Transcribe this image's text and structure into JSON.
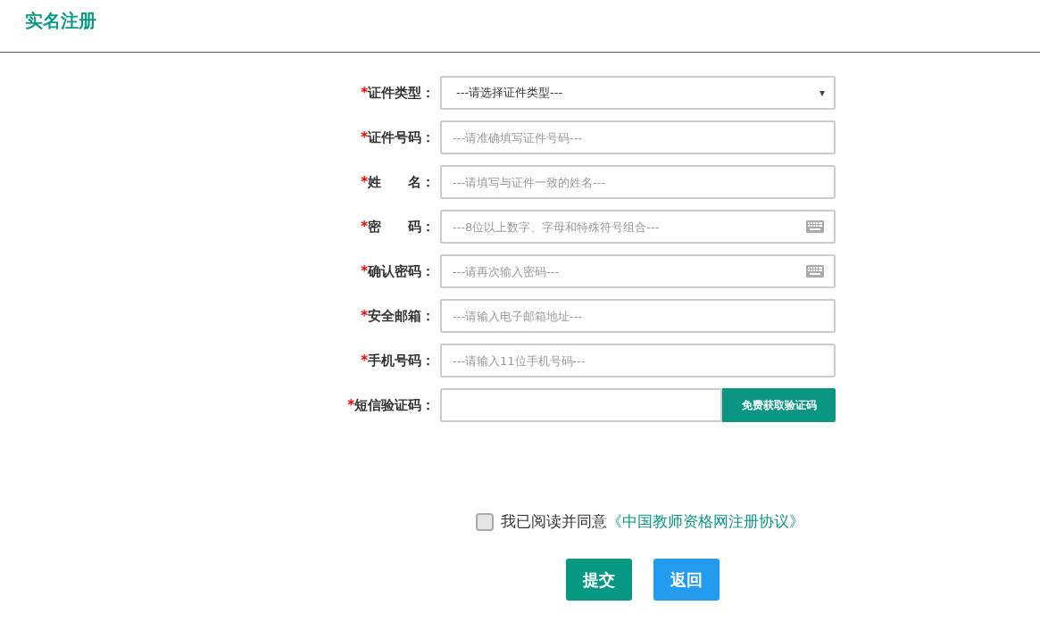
{
  "title": "实名注册",
  "fields": [
    {
      "kind": "select",
      "mark": "*",
      "label": "证件类型：",
      "value": "---请选择证件类型---",
      "caret": "▾"
    },
    {
      "kind": "text",
      "mark": "*",
      "label": "证件号码：",
      "placeholder": "---请准确填写证件号码---"
    },
    {
      "kind": "text",
      "mark": "*",
      "label": "姓　　名：",
      "placeholder": "---请填写与证件一致的姓名---"
    },
    {
      "kind": "password",
      "mark": "*",
      "label": "密　　码：",
      "placeholder": "---8位以上数字、字母和特殊符号组合---"
    },
    {
      "kind": "password",
      "mark": "*",
      "label": "确认密码：",
      "placeholder": "---请再次输入密码---"
    },
    {
      "kind": "text",
      "mark": "*",
      "label": "安全邮箱：",
      "placeholder": "---请输入电子邮箱地址---"
    },
    {
      "kind": "text",
      "mark": "*",
      "label": "手机号码：",
      "placeholder": "---请输入11位手机号码---"
    },
    {
      "kind": "sms",
      "mark": "*",
      "label": "短信验证码：",
      "button": "免费获取验证码"
    }
  ],
  "agreement": {
    "checked": false,
    "text": "我已阅读并同意",
    "link": "《中国教师资格网注册协议》"
  },
  "buttons": [
    {
      "kind": "primary",
      "label": "提交"
    },
    {
      "kind": "secondary",
      "label": "返回"
    }
  ]
}
